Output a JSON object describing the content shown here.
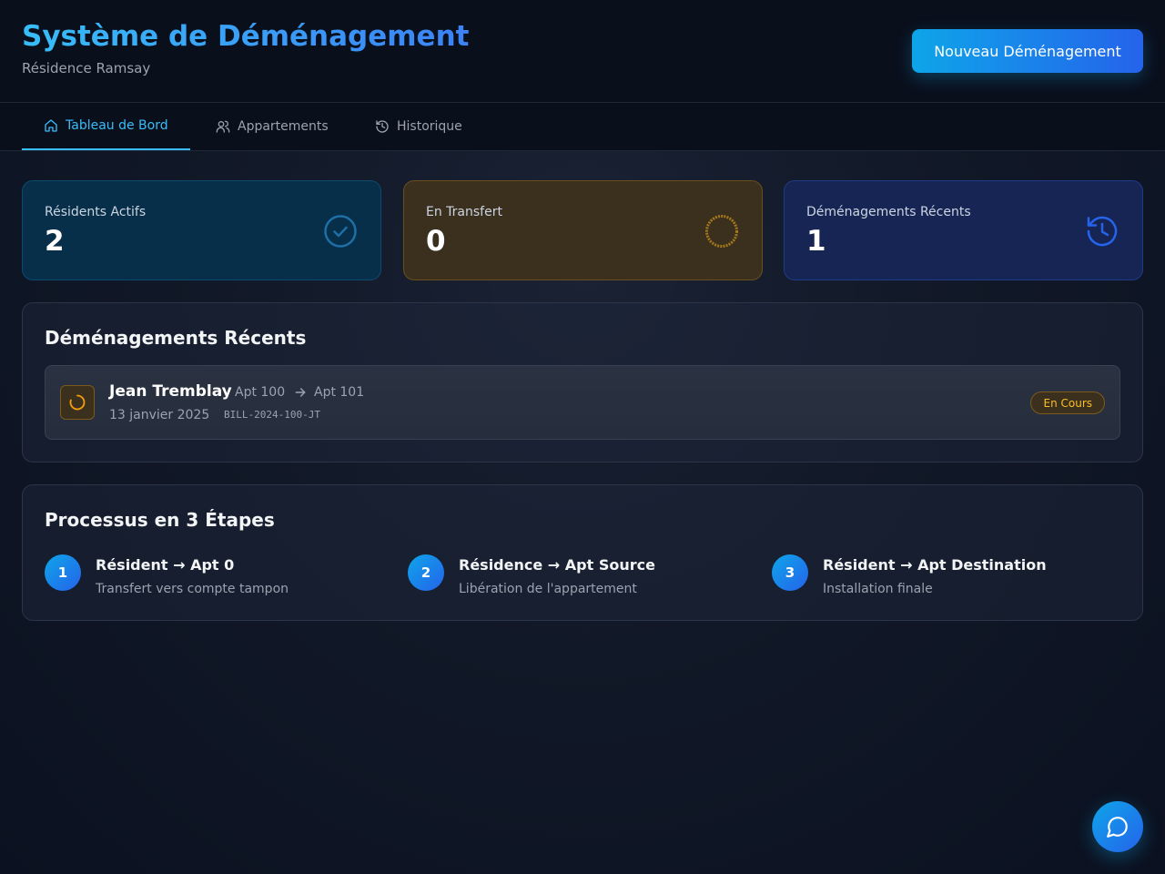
{
  "header": {
    "title": "Système de Déménagement",
    "subtitle": "Résidence Ramsay",
    "new_button_label": "Nouveau Déménagement"
  },
  "tabs": [
    {
      "label": "Tableau de Bord",
      "icon": "home-icon",
      "active": true
    },
    {
      "label": "Appartements",
      "icon": "users-icon",
      "active": false
    },
    {
      "label": "Historique",
      "icon": "history-icon",
      "active": false
    }
  ],
  "stats": [
    {
      "label": "Résidents Actifs",
      "value": "2",
      "icon": "check-circle-icon",
      "color": "#0ea5e9"
    },
    {
      "label": "En Transfert",
      "value": "0",
      "icon": "loader-ring-icon",
      "color": "#f59e0b"
    },
    {
      "label": "Déménagements Récents",
      "value": "1",
      "icon": "history-icon",
      "color": "#3b82f6"
    }
  ],
  "recent": {
    "title": "Déménagements Récents",
    "items": [
      {
        "name": "Jean Tremblay",
        "from": "Apt 100",
        "to": "Apt 101",
        "date": "13 janvier 2025",
        "bill": "BILL-2024-100-JT",
        "status": "En Cours",
        "icon": "loader-icon"
      }
    ]
  },
  "process": {
    "title": "Processus en 3 Étapes",
    "steps": [
      {
        "number": "1",
        "title": "Résident → Apt 0",
        "description": "Transfert vers compte tampon"
      },
      {
        "number": "2",
        "title": "Résidence → Apt Source",
        "description": "Libération de l'appartement"
      },
      {
        "number": "3",
        "title": "Résident → Apt Destination",
        "description": "Installation finale"
      }
    ]
  },
  "chat": {
    "icon": "chat-bubble-icon"
  },
  "colors": {
    "accent": "#38bdf8",
    "accent_dark": "#2563eb",
    "warning": "#fbbf24"
  }
}
